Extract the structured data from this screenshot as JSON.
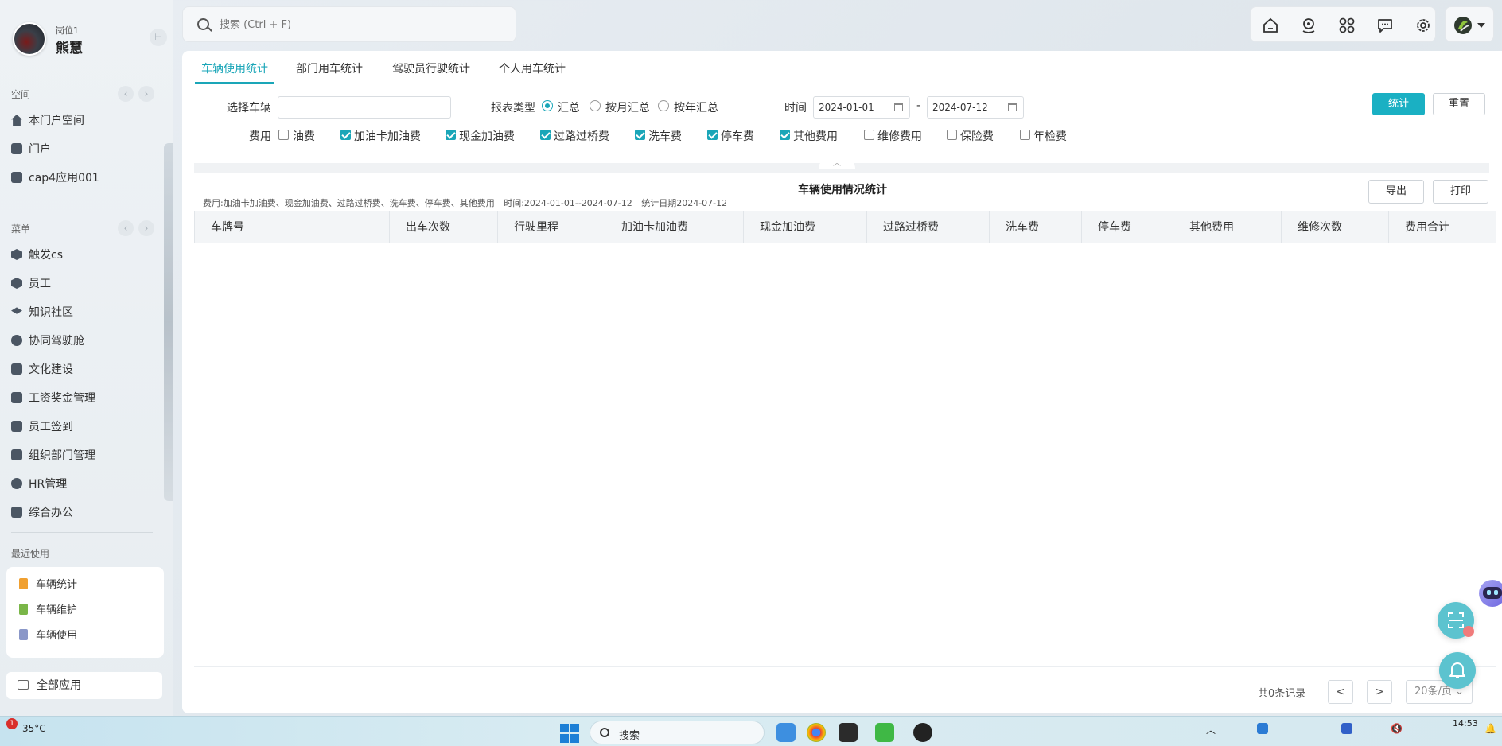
{
  "user": {
    "post": "岗位1",
    "name": "熊慧"
  },
  "sidebar": {
    "space_title": "空间",
    "space_items": [
      {
        "label": "本门户空间",
        "icon": "home-icon"
      },
      {
        "label": "门户",
        "icon": "portal-icon"
      },
      {
        "label": "cap4应用001",
        "icon": "app-icon"
      }
    ],
    "menu_title": "菜单",
    "menu_items": [
      {
        "label": "触发cs",
        "icon": "cube-icon"
      },
      {
        "label": "员工",
        "icon": "cube-icon"
      },
      {
        "label": "知识社区",
        "icon": "graduation-cap-icon"
      },
      {
        "label": "协同驾驶舱",
        "icon": "gauge-icon"
      },
      {
        "label": "文化建设",
        "icon": "id-card-icon"
      },
      {
        "label": "工资奖金管理",
        "icon": "wallet-icon"
      },
      {
        "label": "员工签到",
        "icon": "calendar-check-icon"
      },
      {
        "label": "组织部门管理",
        "icon": "org-icon"
      },
      {
        "label": "HR管理",
        "icon": "hr-icon"
      },
      {
        "label": "综合办公",
        "icon": "doc-edit-icon"
      }
    ],
    "recent_title": "最近使用",
    "recent_items": [
      {
        "label": "车辆统计",
        "color": "#f0a030"
      },
      {
        "label": "车辆维护",
        "color": "#7ab648"
      },
      {
        "label": "车辆使用",
        "color": "#8a97c8"
      }
    ],
    "all_apps": "全部应用"
  },
  "search": {
    "placeholder": "搜索 (Ctrl + F)"
  },
  "topbar_icons": [
    "home-icon",
    "location-icon",
    "apps-grid-icon",
    "chat-icon",
    "settings-icon"
  ],
  "tabs": [
    "车辆使用统计",
    "部门用车统计",
    "驾驶员行驶统计",
    "个人用车统计"
  ],
  "filters": {
    "vehicle_label": "选择车辆",
    "vehicle_value": "",
    "report_type_label": "报表类型",
    "report_types": [
      {
        "label": "汇总",
        "selected": true
      },
      {
        "label": "按月汇总",
        "selected": false
      },
      {
        "label": "按年汇总",
        "selected": false
      }
    ],
    "time_label": "时间",
    "date_from": "2024-01-01",
    "date_sep": "-",
    "date_to": "2024-07-12",
    "stat_button": "统计",
    "reset_button": "重置",
    "fee_label": "费用",
    "fees": [
      {
        "label": "油费",
        "checked": false
      },
      {
        "label": "加油卡加油费",
        "checked": true
      },
      {
        "label": "现金加油费",
        "checked": true
      },
      {
        "label": "过路过桥费",
        "checked": true
      },
      {
        "label": "洗车费",
        "checked": true
      },
      {
        "label": "停车费",
        "checked": true
      },
      {
        "label": "其他费用",
        "checked": true
      },
      {
        "label": "维修费用",
        "checked": false
      },
      {
        "label": "保险费",
        "checked": false
      },
      {
        "label": "年检费",
        "checked": false
      }
    ]
  },
  "report": {
    "title": "车辆使用情况统计",
    "meta_fees": "费用:加油卡加油费、现金加油费、过路过桥费、洗车费、停车费、其他费用",
    "meta_time": "时间:2024-01-01--2024-07-12",
    "meta_date": "统计日期2024-07-12",
    "export_button": "导出",
    "print_button": "打印",
    "columns": [
      "车牌号",
      "出车次数",
      "行驶里程",
      "加油卡加油费",
      "现金加油费",
      "过路过桥费",
      "洗车费",
      "停车费",
      "其他费用",
      "维修次数",
      "费用合计"
    ],
    "rows": []
  },
  "pager": {
    "total": "共0条记录",
    "prev": "<",
    "next": ">",
    "page_size": "20条/页"
  },
  "taskbar": {
    "weather_temp": "35°C",
    "weather_badge": "1",
    "search_label": "搜索",
    "time": "14:53"
  },
  "colors": {
    "accent": "#1aa6b8",
    "primary_button": "#1ab0c3"
  }
}
